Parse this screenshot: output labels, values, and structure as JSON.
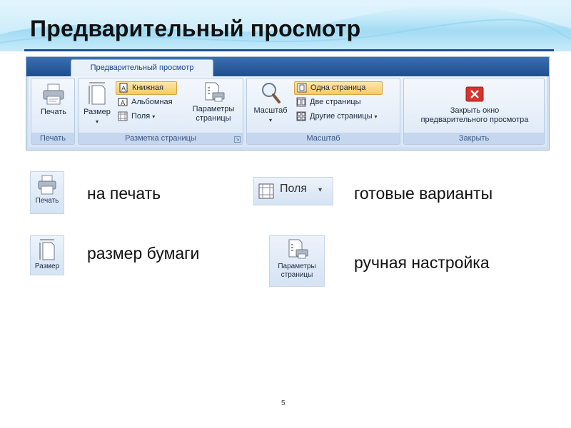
{
  "slide": {
    "title": "Предварительный просмотр",
    "page_number": "5"
  },
  "ribbon": {
    "active_tab": "Предварительный просмотр",
    "groups": {
      "print": {
        "label": "Печать",
        "print_button": "Печать"
      },
      "page_setup": {
        "label": "Разметка страницы",
        "size_button": "Размер",
        "portrait_button": "Книжная",
        "landscape_button": "Альбомная",
        "margins_button": "Поля",
        "page_params_line1": "Параметры",
        "page_params_line2": "страницы"
      },
      "zoom": {
        "label": "Масштаб",
        "zoom_button": "Масштаб",
        "one_page": "Одна страница",
        "two_pages": "Две страницы",
        "other_pages": "Другие страницы"
      },
      "close": {
        "label": "Закрыть",
        "close_line1": "Закрыть окно",
        "close_line2": "предварительного просмотра"
      }
    }
  },
  "examples": [
    {
      "tile_label": "Печать",
      "caption": "на печать"
    },
    {
      "tile_label": "Размер",
      "caption": "размер бумаги"
    },
    {
      "tile_label": "Поля",
      "caption": "готовые варианты"
    },
    {
      "tile_label_line1": "Параметры",
      "tile_label_line2": "страницы",
      "caption": "ручная настройка"
    }
  ],
  "colors": {
    "title_rule": "#1f4e9a",
    "ribbon_tabstrip": "#2a5c9e",
    "active_button": "#f8c964",
    "close_icon": "#d9322b"
  },
  "icons": [
    "printer-icon",
    "page-size-icon",
    "portrait-icon",
    "landscape-icon",
    "margins-icon",
    "page-setup-icon",
    "magnifier-icon",
    "one-page-icon",
    "two-pages-icon",
    "multiple-pages-icon",
    "close-icon"
  ]
}
